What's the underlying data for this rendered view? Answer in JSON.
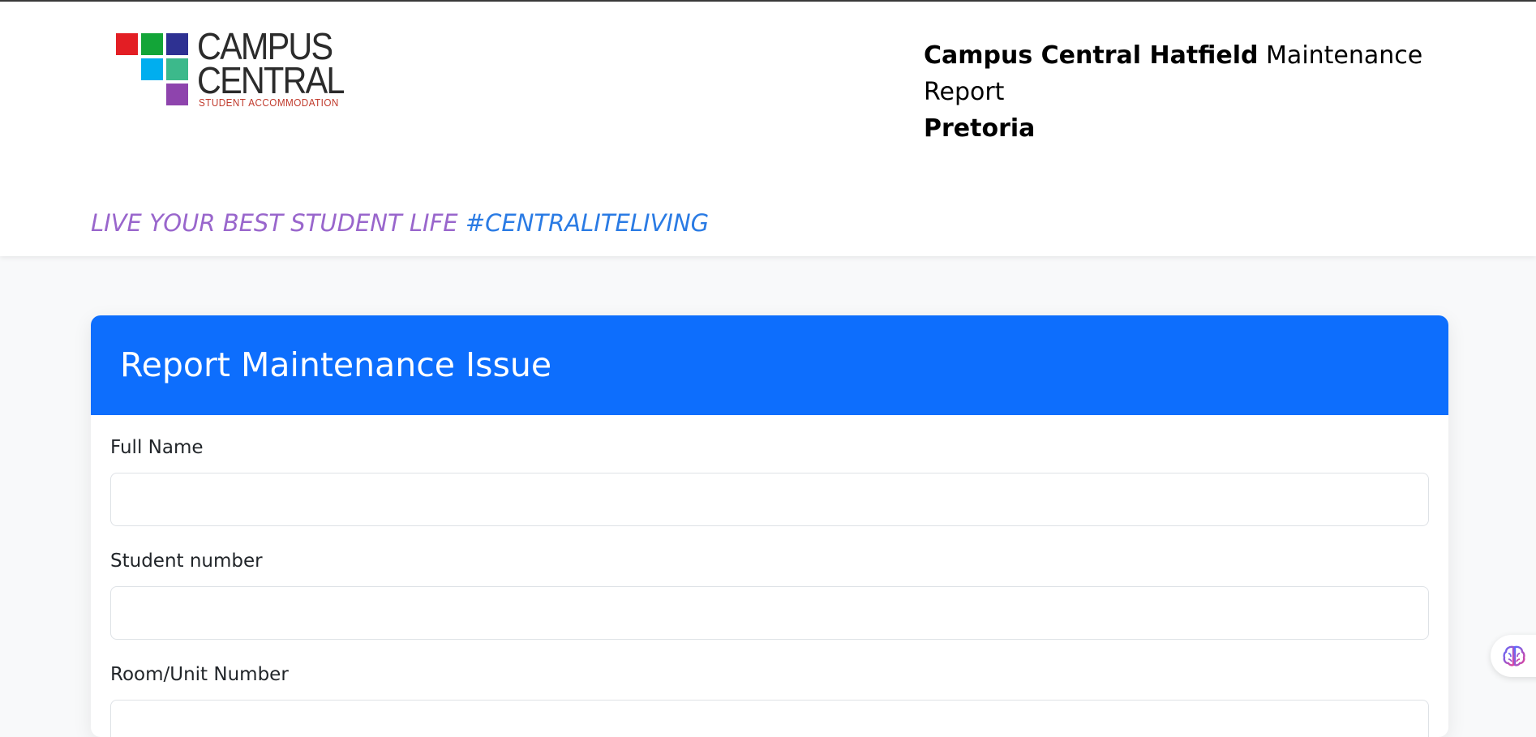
{
  "header": {
    "logo": {
      "line1": "CAMPUS",
      "line2": "CENTRAL",
      "subtitle": "STUDENT ACCOMMODATION",
      "colors": [
        "#e31e24",
        "#13a538",
        "#2e3192",
        "#00aeef",
        "#3cb98b",
        "#8e44ad"
      ]
    },
    "title_bold": "Campus Central Hatfield",
    "title_rest": " Maintenance Report",
    "title_line2": "Pretoria",
    "tagline_part1": "LIVE YOUR BEST STUDENT LIFE",
    "tagline_part2": " #CENTRALITELIVING"
  },
  "form": {
    "title": "Report Maintenance Issue",
    "fields": [
      {
        "label": "Full Name",
        "value": "",
        "placeholder": ""
      },
      {
        "label": "Student number",
        "value": "",
        "placeholder": ""
      },
      {
        "label": "Room/Unit Number",
        "value": "",
        "placeholder": ""
      }
    ]
  },
  "assistant": {
    "icon": "brain-icon"
  },
  "colors": {
    "primary": "#0d6efd",
    "tagline_purple": "#9966cc",
    "tagline_blue": "#2a7be4"
  }
}
